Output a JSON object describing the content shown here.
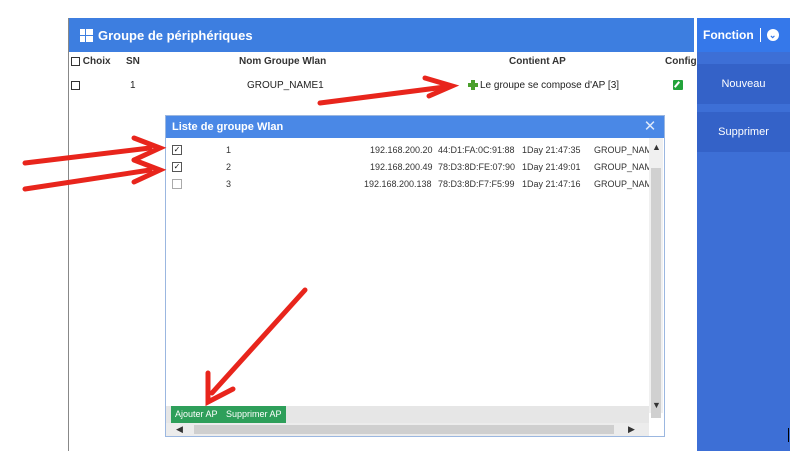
{
  "panel": {
    "title": "Groupe de périphériques",
    "columns": {
      "choice": "Choix",
      "sn": "SN",
      "name": "Nom Groupe Wlan",
      "contains": "Contient AP",
      "config": "Config"
    },
    "row": {
      "sn": "1",
      "name": "GROUP_NAME1",
      "contains": "Le groupe se compose d'AP [3]"
    }
  },
  "sidebar": {
    "header": "Fonction",
    "buttons": {
      "new": "Nouveau",
      "delete": "Supprimer"
    }
  },
  "modal": {
    "title": "Liste de groupe Wlan",
    "rows": [
      {
        "checked": true,
        "num": "1",
        "ip": "192.168.200.20",
        "mac": "44:D1:FA:0C:91:88",
        "time": "1Day 21:47:35",
        "group": "GROUP_NAMI"
      },
      {
        "checked": true,
        "num": "2",
        "ip": "192.168.200.49",
        "mac": "78:D3:8D:FE:07:90",
        "time": "1Day 21:49:01",
        "group": "GROUP_NAMI"
      },
      {
        "checked": false,
        "num": "3",
        "ip": "192.168.200.138",
        "mac": "78:D3:8D:F7:F5:99",
        "time": "1Day 21:47:16",
        "group": "GROUP_NAMI"
      }
    ],
    "buttons": {
      "add": "Ajouter AP",
      "remove": "Supprimer AP"
    }
  },
  "colors": {
    "accent": "#3d7ee0",
    "arrow": "#e8251c",
    "button_green": "#2e9f5a"
  },
  "icons": [
    "grid-icon",
    "chevron-down-icon",
    "plus-icon",
    "edit-icon",
    "close-icon",
    "check-icon",
    "scroll-arrow-icon"
  ]
}
